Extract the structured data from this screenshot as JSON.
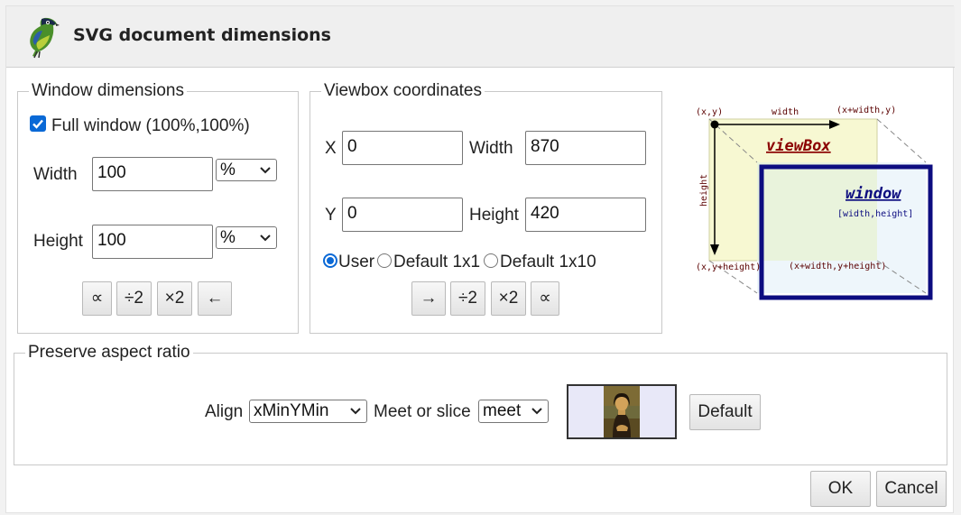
{
  "title": "SVG document dimensions",
  "window_dimensions": {
    "legend": "Window dimensions",
    "full_window_label": "Full window (100%,100%)",
    "full_window_checked": true,
    "width_label": "Width",
    "width_value": "100",
    "width_unit": "%",
    "height_label": "Height",
    "height_value": "100",
    "height_unit": "%",
    "buttons": [
      "∝",
      "÷2",
      "×2",
      "←"
    ]
  },
  "viewbox": {
    "legend": "Viewbox coordinates",
    "x_label": "X",
    "x_value": "0",
    "width_label": "Width",
    "width_value": "870",
    "y_label": "Y",
    "y_value": "0",
    "height_label": "Height",
    "height_value": "420",
    "radios": [
      "User",
      "Default 1x1",
      "Default 1x10"
    ],
    "selected_radio": "User",
    "buttons": [
      "→",
      "÷2",
      "×2",
      "∝"
    ]
  },
  "diagram": {
    "corner_tl": "(x,y)",
    "top_width": "width",
    "corner_tr": "(x+width,y)",
    "side_height": "height",
    "viewbox_label": "viewBox",
    "window_label": "window",
    "window_dims": "[width,height]",
    "corner_bl": "(x,y+height)",
    "corner_br": "(x+width,y+height)",
    "colors": {
      "viewbox_fill": "#f7f8d2",
      "window_border": "#0d0d80",
      "label_red": "#8b0000"
    }
  },
  "preserve_aspect": {
    "legend": "Preserve aspect ratio",
    "align_label": "Align",
    "align_value": "xMinYMin",
    "meet_label": "Meet or slice",
    "meet_value": "meet",
    "default_button": "Default",
    "preview_bg": "#e8e8f8"
  },
  "footer": {
    "ok": "OK",
    "cancel": "Cancel"
  }
}
